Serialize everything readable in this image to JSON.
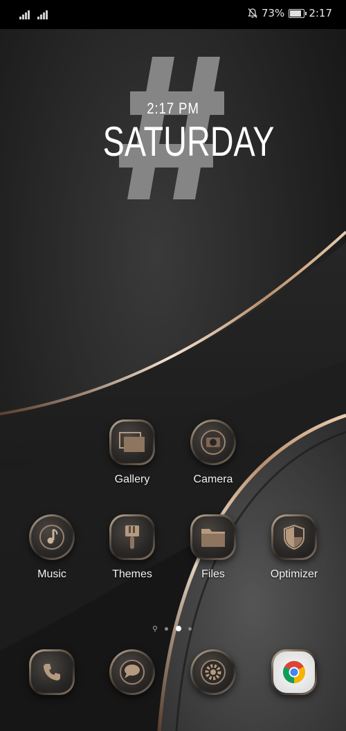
{
  "status_bar": {
    "battery_percent": "73%",
    "battery_level": 0.73,
    "time": "2:17",
    "icons": [
      "signal-icon",
      "signal-icon",
      "notifications-muted-icon",
      "battery-icon"
    ]
  },
  "clock_widget": {
    "time": "2:17 PM",
    "day": "SATURDAY",
    "symbol": "#"
  },
  "apps": [
    {
      "label": "Gallery",
      "icon": "gallery-icon"
    },
    {
      "label": "Camera",
      "icon": "camera-icon"
    },
    {
      "label": "Music",
      "icon": "music-icon"
    },
    {
      "label": "Themes",
      "icon": "themes-icon"
    },
    {
      "label": "Files",
      "icon": "files-icon"
    },
    {
      "label": "Optimizer",
      "icon": "optimizer-icon"
    }
  ],
  "page_indicator": {
    "pages": 3,
    "current": 2,
    "has_search_page": true
  },
  "dock": [
    {
      "icon": "phone-icon"
    },
    {
      "icon": "messages-icon"
    },
    {
      "icon": "settings-icon"
    },
    {
      "icon": "chrome-icon"
    }
  ],
  "colors": {
    "accent_gold": "#c9a784",
    "background": "#151515"
  }
}
